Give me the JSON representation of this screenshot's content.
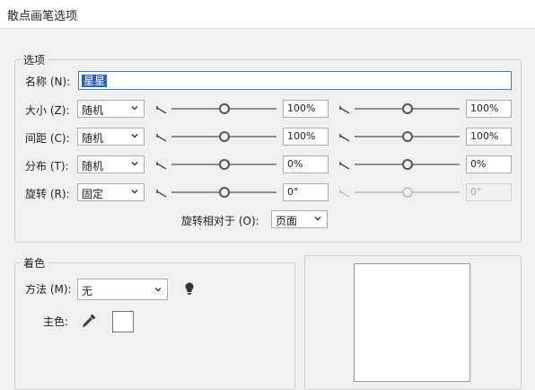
{
  "dialog": {
    "title": "散点画笔选项"
  },
  "options": {
    "legend": "选项",
    "name_label": "名称 (N):",
    "name_value": "星星",
    "rows": [
      {
        "label": "大小 (Z):",
        "mode": "随机",
        "min_value": "100%",
        "max_value": "100%",
        "min_position": 0.5,
        "max_position": 0.5,
        "disabled": false
      },
      {
        "label": "间距 (C):",
        "mode": "随机",
        "min_value": "100%",
        "max_value": "100%",
        "min_position": 0.5,
        "max_position": 0.5,
        "disabled": false
      },
      {
        "label": "分布 (T):",
        "mode": "随机",
        "min_value": "0%",
        "max_value": "0%",
        "min_position": 0.5,
        "max_position": 0.5,
        "disabled": false
      },
      {
        "label": "旋转 (R):",
        "mode": "固定",
        "min_value": "0°",
        "max_value": "0°",
        "min_position": 0.5,
        "max_position": 0.5,
        "disabled": true
      }
    ],
    "rotate_relative_label": "旋转相对于 (O):",
    "rotate_relative_value": "页面"
  },
  "colorization": {
    "legend": "着色",
    "method_label": "方法 (M):",
    "method_value": "无",
    "key_color_label": "主色:",
    "tips_icon": "lightbulb-icon",
    "eyedropper_icon": "eyedropper-icon"
  }
}
